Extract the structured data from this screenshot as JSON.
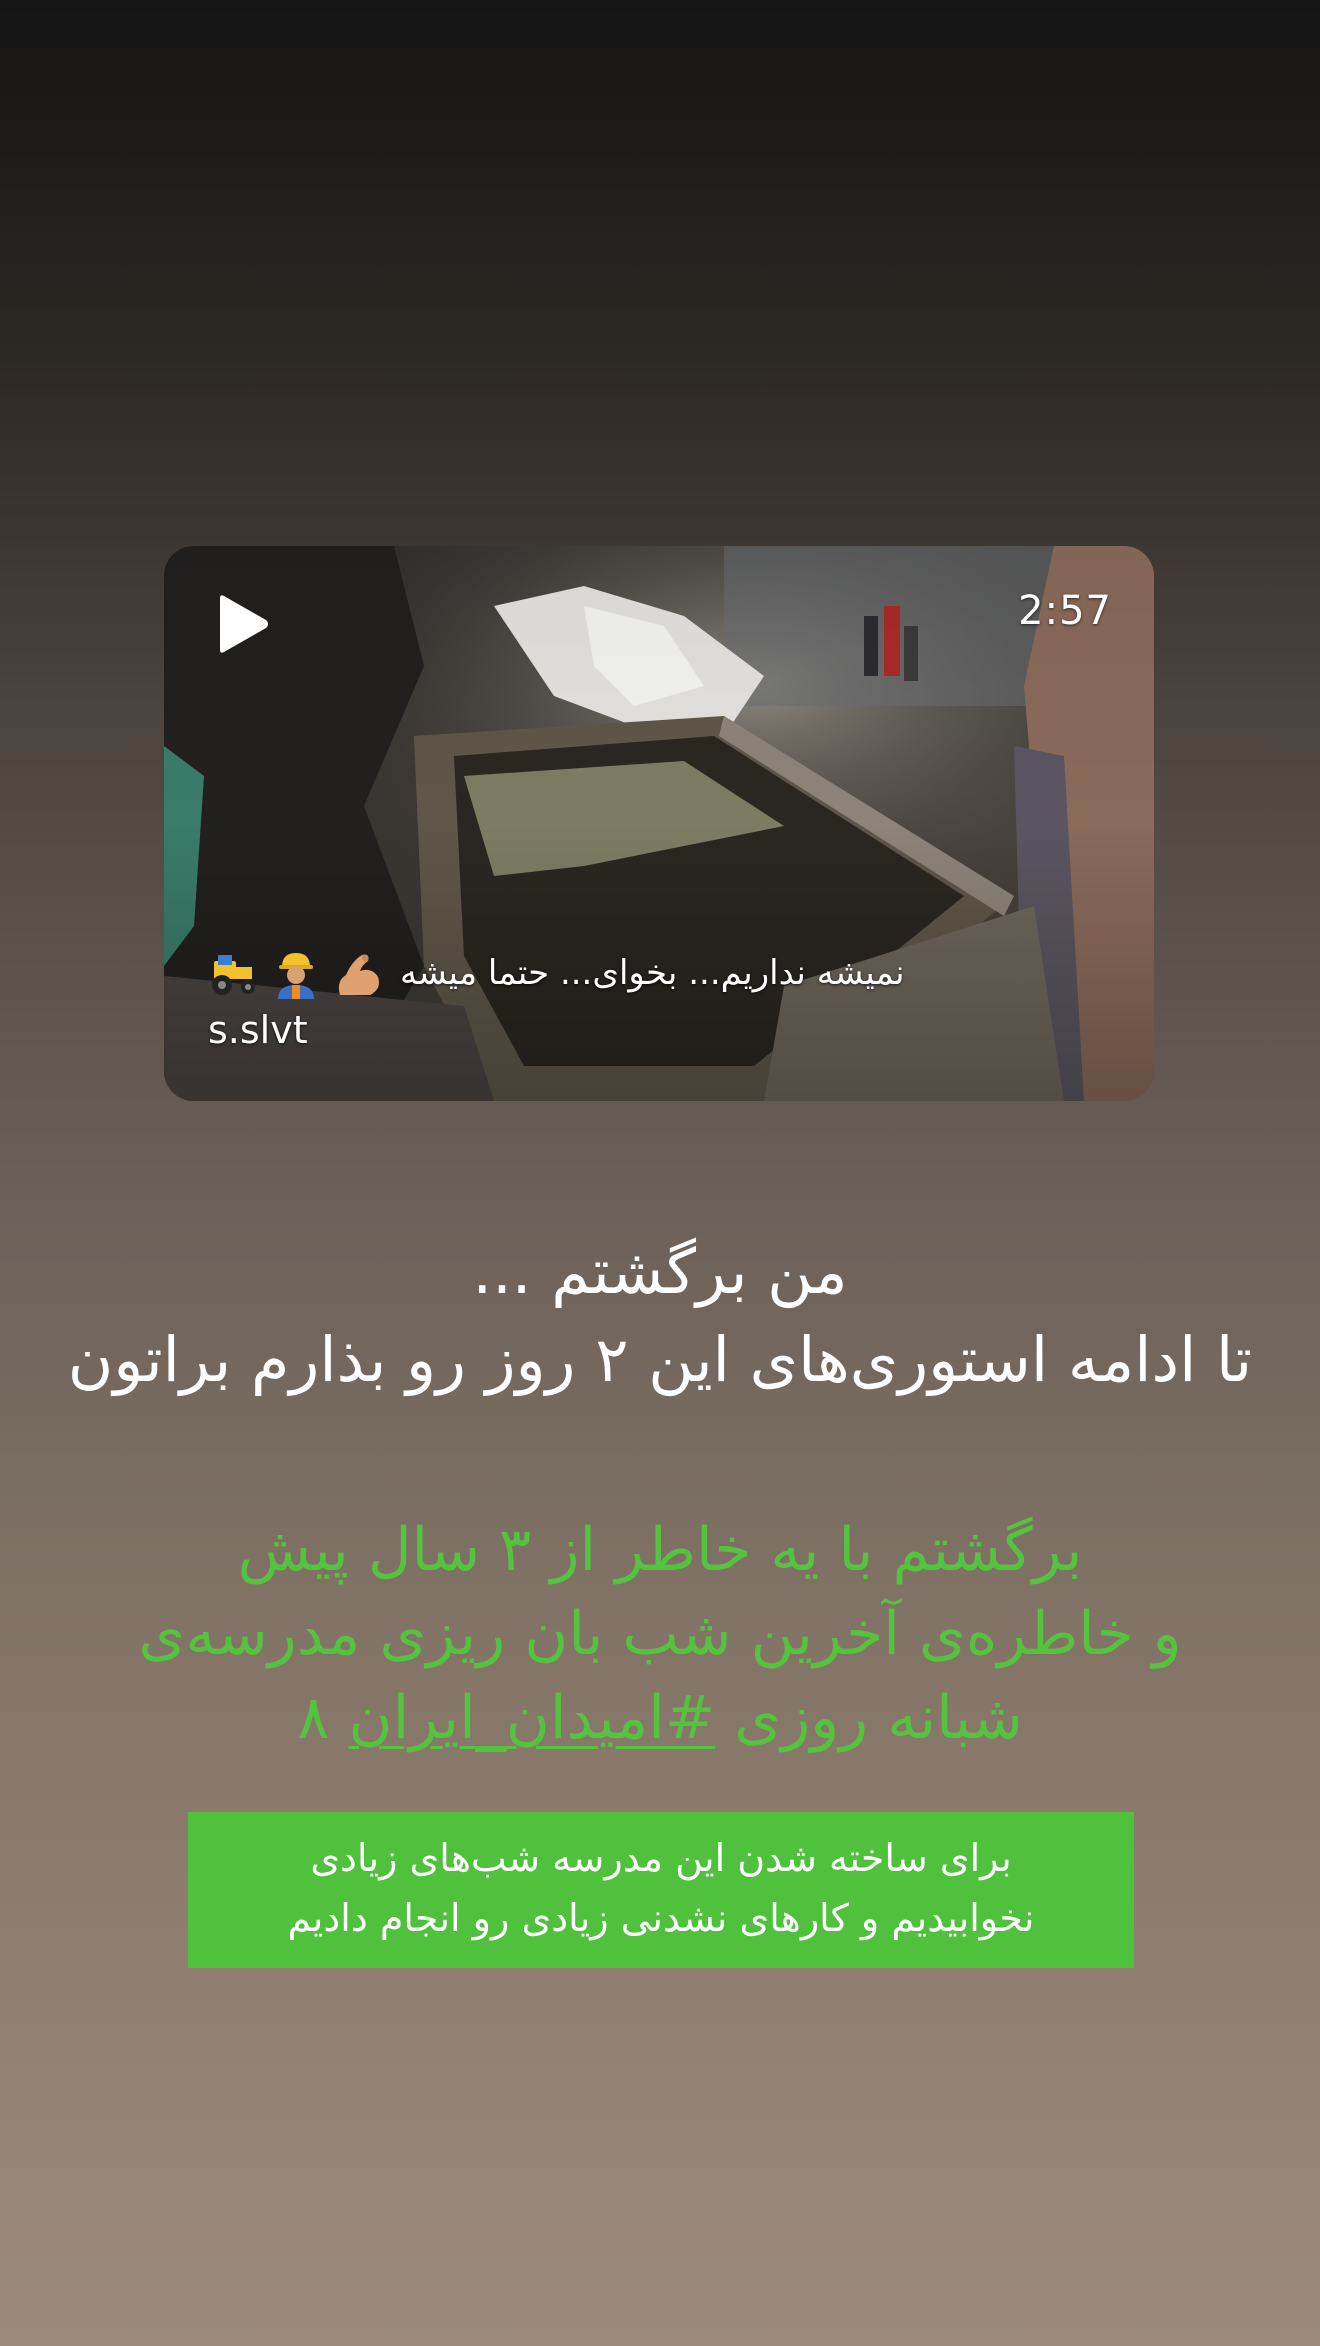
{
  "video_post": {
    "duration": "2:57",
    "caption": "نمیشه نداریم... بخوای... حتما میشه",
    "caption_emojis": [
      "flexed-biceps",
      "construction-worker",
      "tractor"
    ],
    "author": "s.slvt"
  },
  "headline": {
    "line1": "من برگشتم ...",
    "line2": "تا ادامه استوری‌های این ۲ روز رو بذارم براتون"
  },
  "green_message": {
    "line1": "برگشتم با یه خاطر از ۳ سال پیش",
    "line2": "و خاطره‌ی آخرین شب بان ریزی مدرسه‌ی",
    "line3_prefix": "شبانه روزی",
    "hashtag": "#امیدان_ایران",
    "line3_suffix": "۸"
  },
  "green_box": {
    "line1": "برای ساخته شدن این مدرسه شب‌های زیادی",
    "line2": "نخوابیدیم و کارهای نشدنی زیادی رو انجام دادیم"
  },
  "colors": {
    "accent_green_text": "#55c33f",
    "green_box_bg": "#4fc13c"
  }
}
